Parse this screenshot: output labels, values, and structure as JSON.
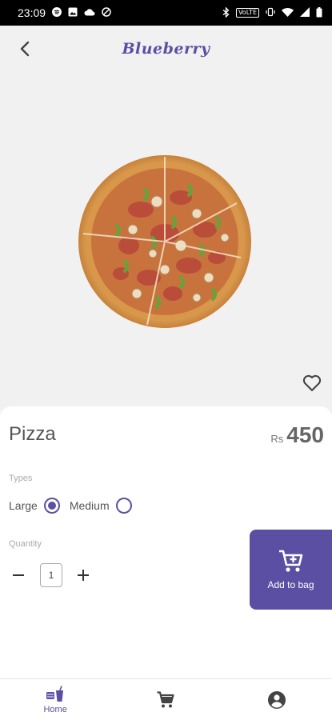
{
  "status_bar": {
    "time": "23:09",
    "network_badge": "VoLTE"
  },
  "header": {
    "brand": "Blueberry",
    "back_icon": "chevron-left-icon",
    "favorite_icon": "heart-outline-icon"
  },
  "product": {
    "name": "Pizza",
    "currency": "Rs",
    "price": "450"
  },
  "types": {
    "label": "Types",
    "options": [
      {
        "label": "Large",
        "selected": true
      },
      {
        "label": "Medium",
        "selected": false
      }
    ]
  },
  "quantity": {
    "label": "Quantity",
    "value": "1"
  },
  "cart_button": {
    "label": "Add to bag"
  },
  "bottom_nav": {
    "items": [
      {
        "label": "Home",
        "icon": "home-food-icon",
        "active": true
      },
      {
        "label": "",
        "icon": "cart-icon",
        "active": false
      },
      {
        "label": "",
        "icon": "account-icon",
        "active": false
      }
    ]
  },
  "colors": {
    "accent": "#5b4fa3",
    "hero_bg": "#f1f1f1",
    "text_muted": "#aaaaaa"
  }
}
